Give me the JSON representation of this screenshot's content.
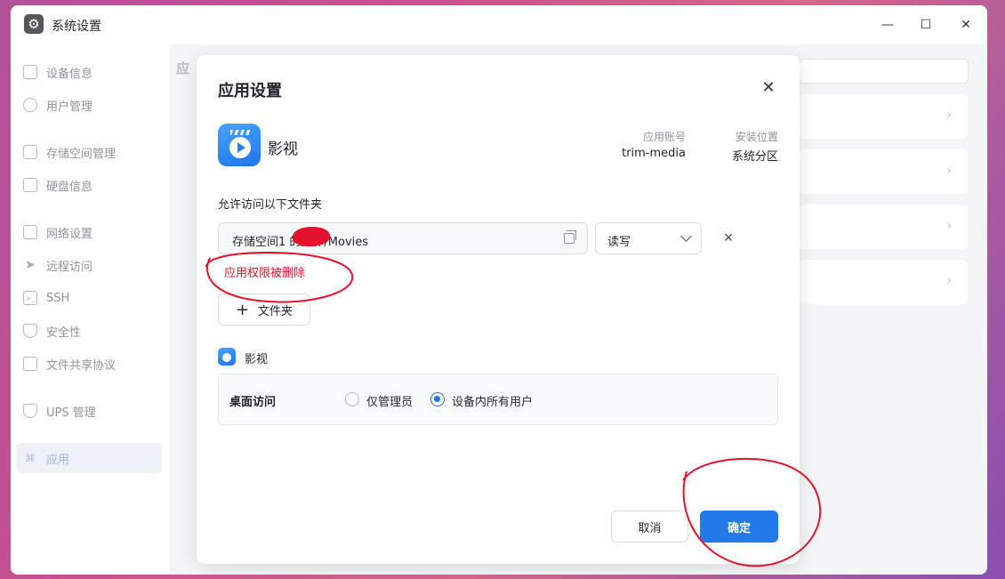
{
  "window": {
    "title": "系统设置",
    "controls": {
      "minimize": "—",
      "maximize": "☐",
      "close": "✕"
    }
  },
  "sidebar": {
    "items": [
      {
        "label": "设备信息",
        "icon": "device-icon"
      },
      {
        "label": "用户管理",
        "icon": "user-icon"
      },
      {
        "label": "存储空间管理",
        "icon": "storage-icon"
      },
      {
        "label": "硬盘信息",
        "icon": "disk-icon"
      },
      {
        "label": "网络设置",
        "icon": "network-icon"
      },
      {
        "label": "远程访问",
        "icon": "remote-icon"
      },
      {
        "label": "SSH",
        "icon": "terminal-icon"
      },
      {
        "label": "安全性",
        "icon": "shield-icon"
      },
      {
        "label": "文件共享协议",
        "icon": "file-icon"
      },
      {
        "label": "UPS 管理",
        "icon": "ups-icon"
      },
      {
        "label": "应用",
        "icon": "apps-icon",
        "active": true
      }
    ]
  },
  "background": {
    "heading": "应"
  },
  "dialog": {
    "title": "应用设置",
    "close": "✕",
    "app": {
      "name": "影视",
      "account_label": "应用账号",
      "account_value": "trim-media",
      "location_label": "安装位置",
      "location_value": "系统分区"
    },
    "folders_label": "允许访问以下文件夹",
    "folder_path": "存储空间1        的文件/Movies",
    "permission": "读写",
    "remove": "✕",
    "error": "应用权限被删除",
    "add_folder": "文件夹",
    "add_plus": "+",
    "section_app": "影视",
    "desktop_access": {
      "label": "桌面访问",
      "options": [
        "仅管理员",
        "设备内所有用户"
      ],
      "selected": 1
    },
    "cancel": "取消",
    "ok": "确定"
  },
  "colors": {
    "accent": "#2279e8",
    "error": "#e3132b",
    "annotation": "#e3132b"
  }
}
